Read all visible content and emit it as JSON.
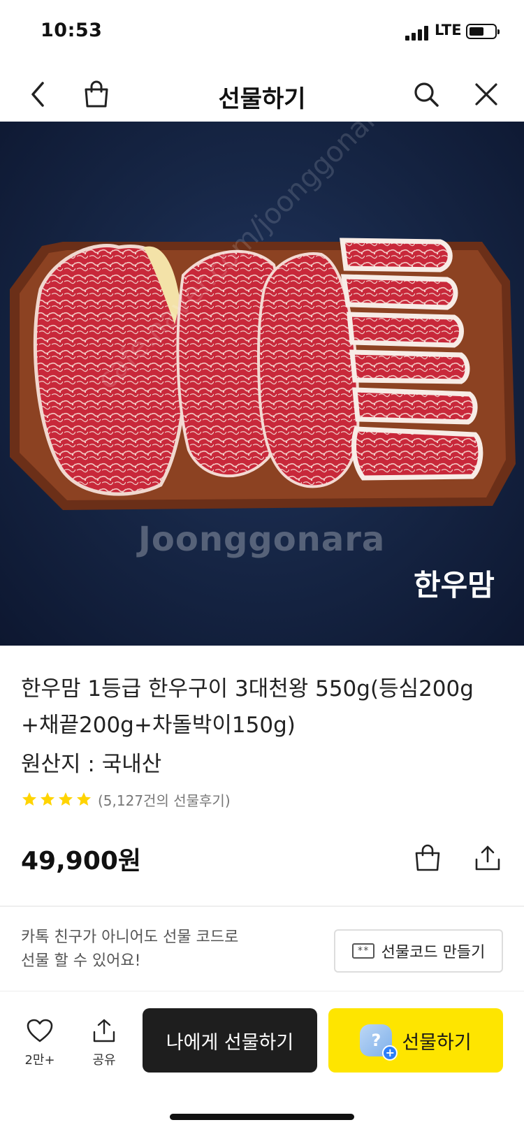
{
  "status_bar": {
    "time": "10:53",
    "network": "LTE",
    "signal_bars": 4,
    "battery_level": 0.6
  },
  "header": {
    "title": "선물하기",
    "icons": [
      "back-icon",
      "shopping-bag-icon",
      "search-icon",
      "close-icon"
    ]
  },
  "hero": {
    "watermark": "Joonggonara",
    "watermark_url": "cafe.naver.com/joonggonara",
    "brand_logo": "한우맘"
  },
  "product": {
    "name": "한우맘 1등급 한우구이 3대천왕 550g(등심200g+채끝200g+차돌박이150g)",
    "origin": "원산지 : 국내산",
    "rating_stars": 4,
    "review_count": "(5,127건의 선물후기)",
    "price": "49,900원"
  },
  "gift_code": {
    "message_line1": "카톡 친구가 아니어도 선물 코드로",
    "message_line2": "선물 할 수 있어요!",
    "icon_text": "**",
    "button_label": "선물코드 만들기"
  },
  "bottom_bar": {
    "wish_count": "2만+",
    "share_label": "공유",
    "self_gift_label": "나에게 선물하기",
    "gift_label": "선물하기"
  },
  "colors": {
    "accent_yellow": "#fee500",
    "dark_button": "#1e1e1e",
    "star": "#ffd400",
    "hero_bg": "#172747"
  }
}
